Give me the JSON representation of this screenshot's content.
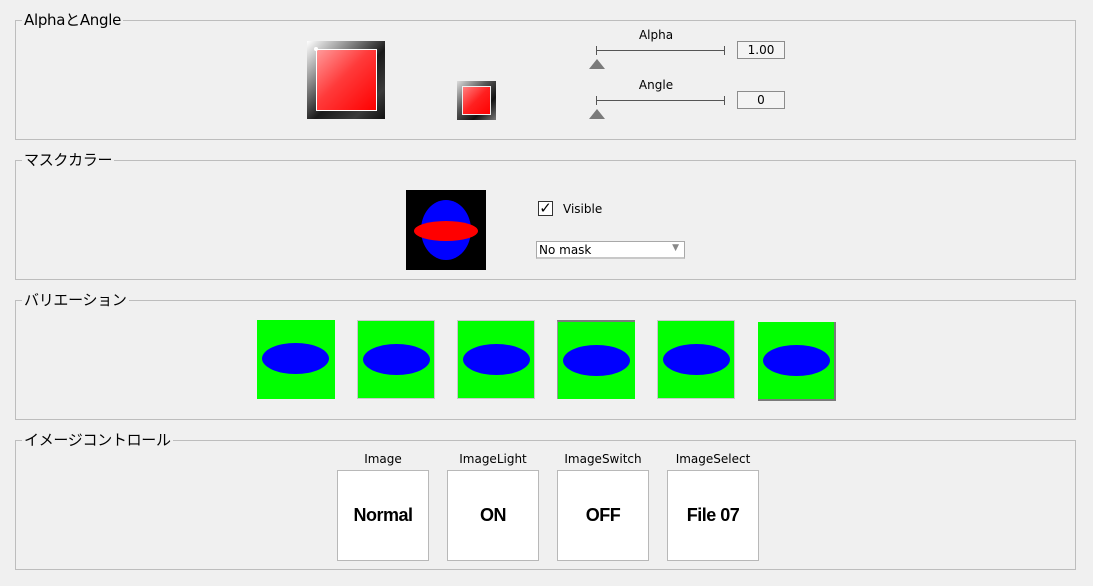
{
  "alpha_angle": {
    "title": "AlphaとAngle",
    "alpha": {
      "label": "Alpha",
      "value": "1.00"
    },
    "angle": {
      "label": "Angle",
      "value": "0"
    }
  },
  "mask_color": {
    "title": "マスクカラー",
    "visible_label": "Visible",
    "visible_checked": true,
    "check_mark": "✓",
    "mask_select": {
      "selected": "No mask"
    }
  },
  "variation": {
    "title": "バリエーション",
    "items": [
      "variation-1",
      "variation-2",
      "variation-3",
      "variation-4",
      "variation-5",
      "variation-6"
    ]
  },
  "image_control": {
    "title": "イメージコントロール",
    "controls": [
      {
        "label": "Image",
        "text": "Normal"
      },
      {
        "label": "ImageLight",
        "text": "ON"
      },
      {
        "label": "ImageSwitch",
        "text": "OFF"
      },
      {
        "label": "ImageSelect",
        "text": "File 07"
      }
    ]
  },
  "colors": {
    "background": "#f0f0f0",
    "red": "#ff0000",
    "green": "#00ff00",
    "blue": "#0000ff"
  }
}
